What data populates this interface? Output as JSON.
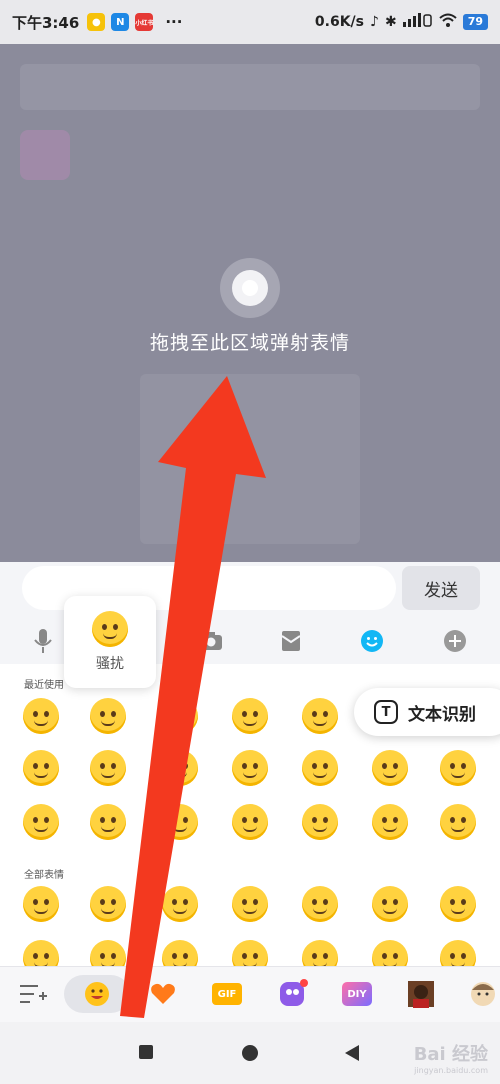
{
  "status_bar": {
    "time": "下午3:46",
    "network_speed": "0.6K/s",
    "battery": "79",
    "more": "···",
    "app_badge_label": "小红书"
  },
  "overlay": {
    "drop_hint": "拖拽至此区域弹射表情"
  },
  "input": {
    "send_label": "发送"
  },
  "preview": {
    "label": "骚扰"
  },
  "panel": {
    "recent_label": "最近使用",
    "all_label": "全部表情"
  },
  "ocr": {
    "label": "文本识别",
    "icon_letter": "T"
  },
  "tabs": {
    "gif_label": "GIF",
    "diy_label": "DIY"
  },
  "watermark": {
    "text": "Bai 经验",
    "sub": "jingyan.baidu.com"
  },
  "colors": {
    "accent_blue": "#2a7ad8",
    "arrow_red": "#f3391f",
    "overlay_grey": "#8b8b9b"
  }
}
